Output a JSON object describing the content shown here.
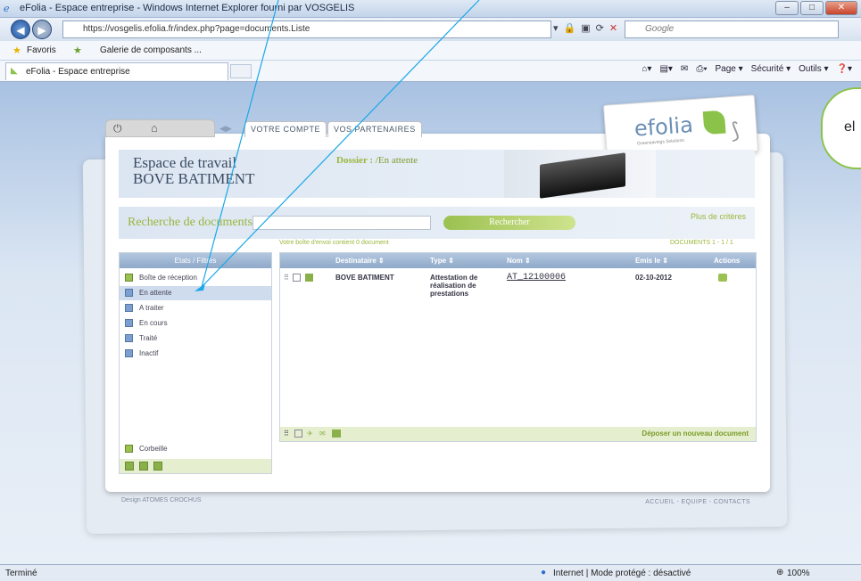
{
  "window": {
    "title": "eFolia - Espace entreprise - Windows Internet Explorer fourni par VOSGELIS",
    "controls": [
      "–",
      "□",
      "✕"
    ]
  },
  "browser": {
    "url": "https://vosgelis.efolia.fr/index.php?page=documents.Liste",
    "search_placeholder": "Google",
    "favorites_label": "Favoris",
    "gallery_label": "Galerie de composants ...",
    "tab_label": "eFolia - Espace entreprise",
    "commands": [
      "Page ▾",
      "Sécurité ▾",
      "Outils ▾",
      "❓▾"
    ]
  },
  "app": {
    "tabs": [
      "VOTRE COMPTE",
      "VOS PARTENAIRES"
    ],
    "logo_text": "efolia",
    "logo_subtitle": "Greensavings Solutions",
    "workspace_title_1": "Espace de travail",
    "workspace_title_2": "BOVE BATIMENT",
    "folder_label": "Dossier :",
    "folder_value": " /En attente",
    "search_label": "Recherche de documents",
    "search_value": "",
    "search_button": "Rechercher",
    "more_criteria": "Plus de critères",
    "mailbox_info": "Votre boîte d'envoi contient 0 document",
    "documents_count": "DOCUMENTS 1 - 1 / 1"
  },
  "sidebar": {
    "header": "Etats / Filtres",
    "items": [
      {
        "label": "Boîte de réception",
        "icon": "inbox-icon"
      },
      {
        "label": "En attente",
        "icon": "pending-icon",
        "selected": true
      },
      {
        "label": "A traiter",
        "icon": "todo-icon"
      },
      {
        "label": "En cours",
        "icon": "in-progress-icon"
      },
      {
        "label": "Traité",
        "icon": "done-icon"
      },
      {
        "label": "Inactif",
        "icon": "inactive-icon"
      }
    ],
    "trash": "Corbeille"
  },
  "table": {
    "headers": [
      "Destinataire ⇕",
      "Type ⇕",
      "Nom ⇕",
      "Emis le ⇕",
      "Actions"
    ],
    "rows": [
      {
        "destinataire": "BOVE BATIMENT",
        "type_1": "Attestation de",
        "type_2": "réalisation de",
        "type_3": "prestations",
        "nom": "AT_12100006",
        "date": "02-10-2012"
      }
    ],
    "upload_link": "Déposer un nouveau document"
  },
  "footer": {
    "design": "Design ATOMES CROCHUS",
    "links": "ACCUEIL - EQUIPE - CONTACTS"
  },
  "statusbar": {
    "left": "Terminé",
    "zone": "Internet | Mode protégé : désactivé",
    "zoom": "100%"
  },
  "annotation": {
    "cloud_text": "el"
  }
}
